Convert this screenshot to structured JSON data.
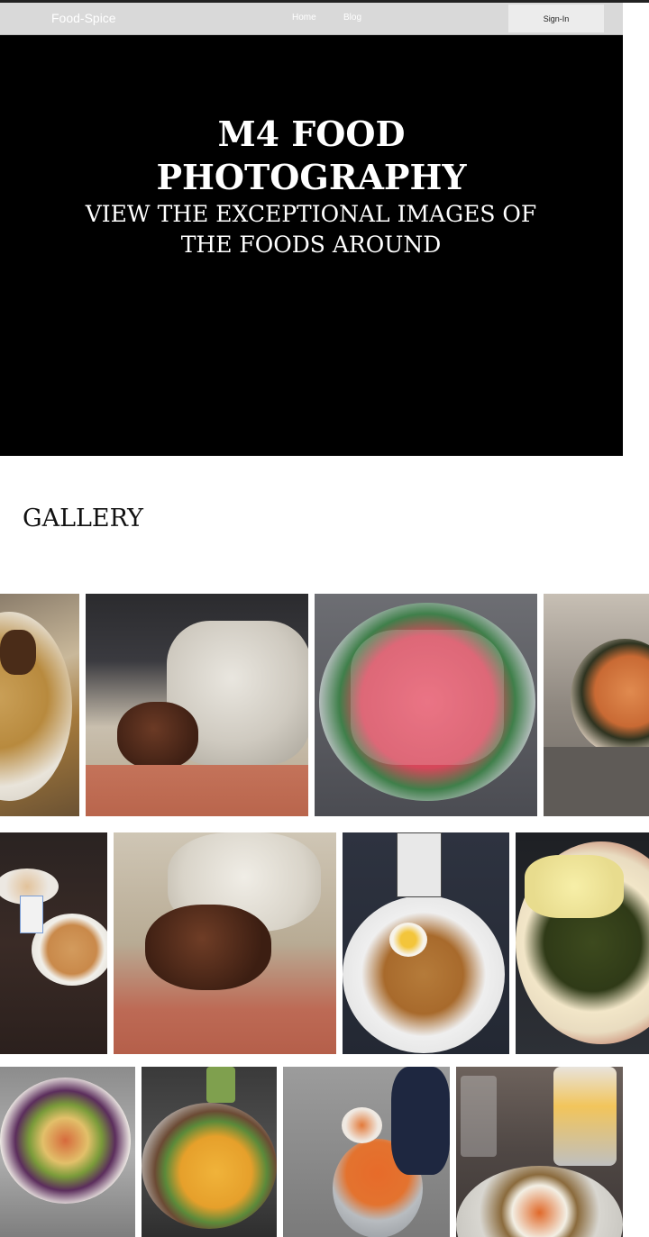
{
  "navbar": {
    "brand": "Food-Spice",
    "links": [
      "Home",
      "Blog"
    ],
    "signin_label": "Sign-In"
  },
  "hero": {
    "title_line1": "M4 FOOD",
    "title_line2": "PHOTOGRAPHY",
    "subtitle_line1": "VIEW THE EXCEPTIONAL IMAGES OF",
    "subtitle_line2": "THE FOODS AROUND"
  },
  "gallery": {
    "heading": "GALLERY",
    "photos": [
      {
        "subject": "rice-and-grilled-meat"
      },
      {
        "subject": "swallow-with-fried-meat"
      },
      {
        "subject": "watermelon-slices"
      },
      {
        "subject": "plated-fish-dish"
      },
      {
        "subject": "bread-and-drinks"
      },
      {
        "subject": "fried-meat-with-pepper-sauce"
      },
      {
        "subject": "spaghetti-with-egg"
      },
      {
        "subject": "yam-with-vegetable-sauce"
      },
      {
        "subject": "mixed-salad-platter"
      },
      {
        "subject": "fries-and-grilled-meat"
      },
      {
        "subject": "jollof-pots"
      },
      {
        "subject": "fries-and-carrot-plate"
      }
    ]
  }
}
